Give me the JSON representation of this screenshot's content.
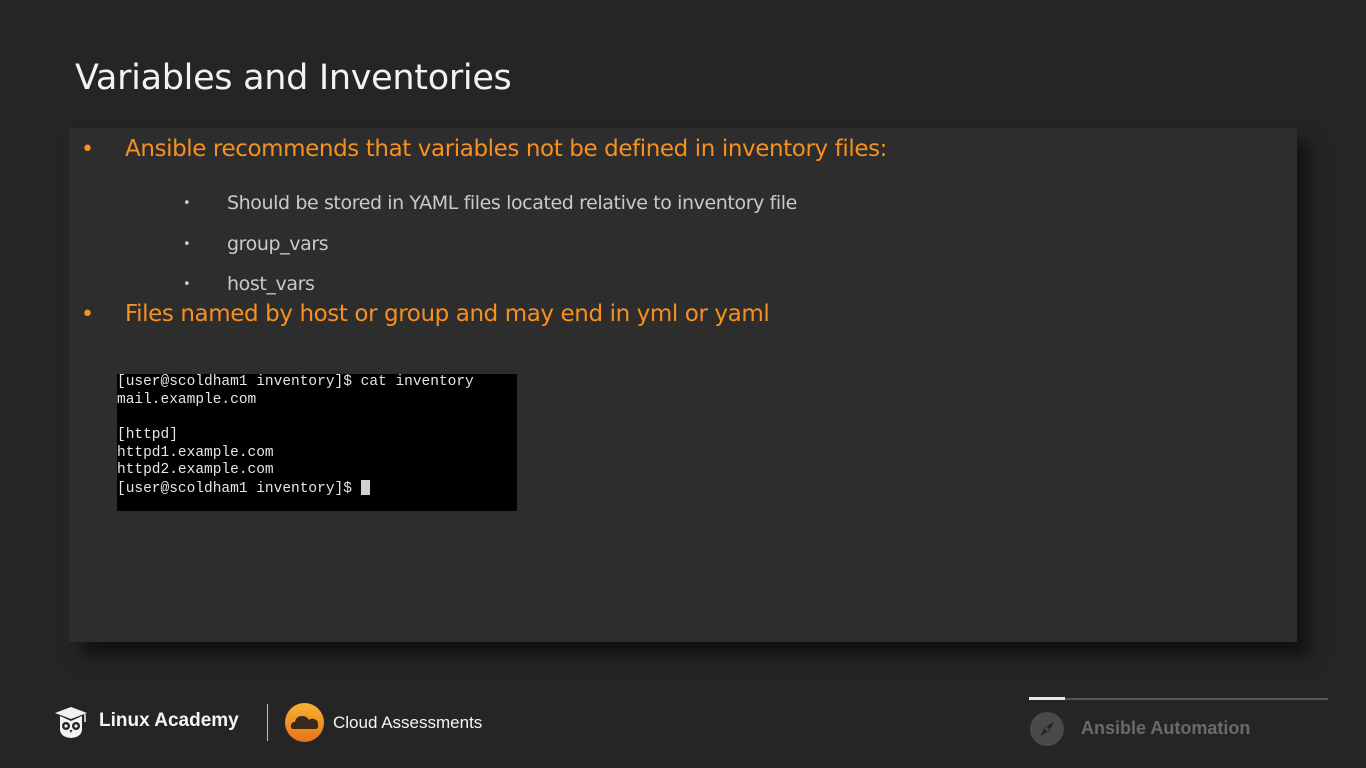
{
  "slide": {
    "title": "Variables and Inventories",
    "bullets": [
      {
        "text": "Ansible recommends that variables not be defined in inventory files:",
        "subbullets": [
          "Should be stored in YAML files located relative to inventory file",
          "group_vars",
          "host_vars"
        ]
      },
      {
        "text": "Files named by host or group and may end in yml or yaml",
        "subbullets": []
      }
    ],
    "bullet_glyph": "•",
    "terminal": {
      "lines": [
        "[user@scoldham1 inventory]$ cat inventory",
        "mail.example.com",
        "",
        "[httpd]",
        "httpd1.example.com",
        "httpd2.example.com",
        "[user@scoldham1 inventory]$ "
      ]
    }
  },
  "footer": {
    "brand1": "Linux Academy",
    "brand2": "Cloud Assessments",
    "course": "Ansible Automation",
    "progress_fraction": 0.12
  },
  "colors": {
    "accent_orange": "#f79020",
    "background": "#252525",
    "panel": "#2d2d2d"
  }
}
